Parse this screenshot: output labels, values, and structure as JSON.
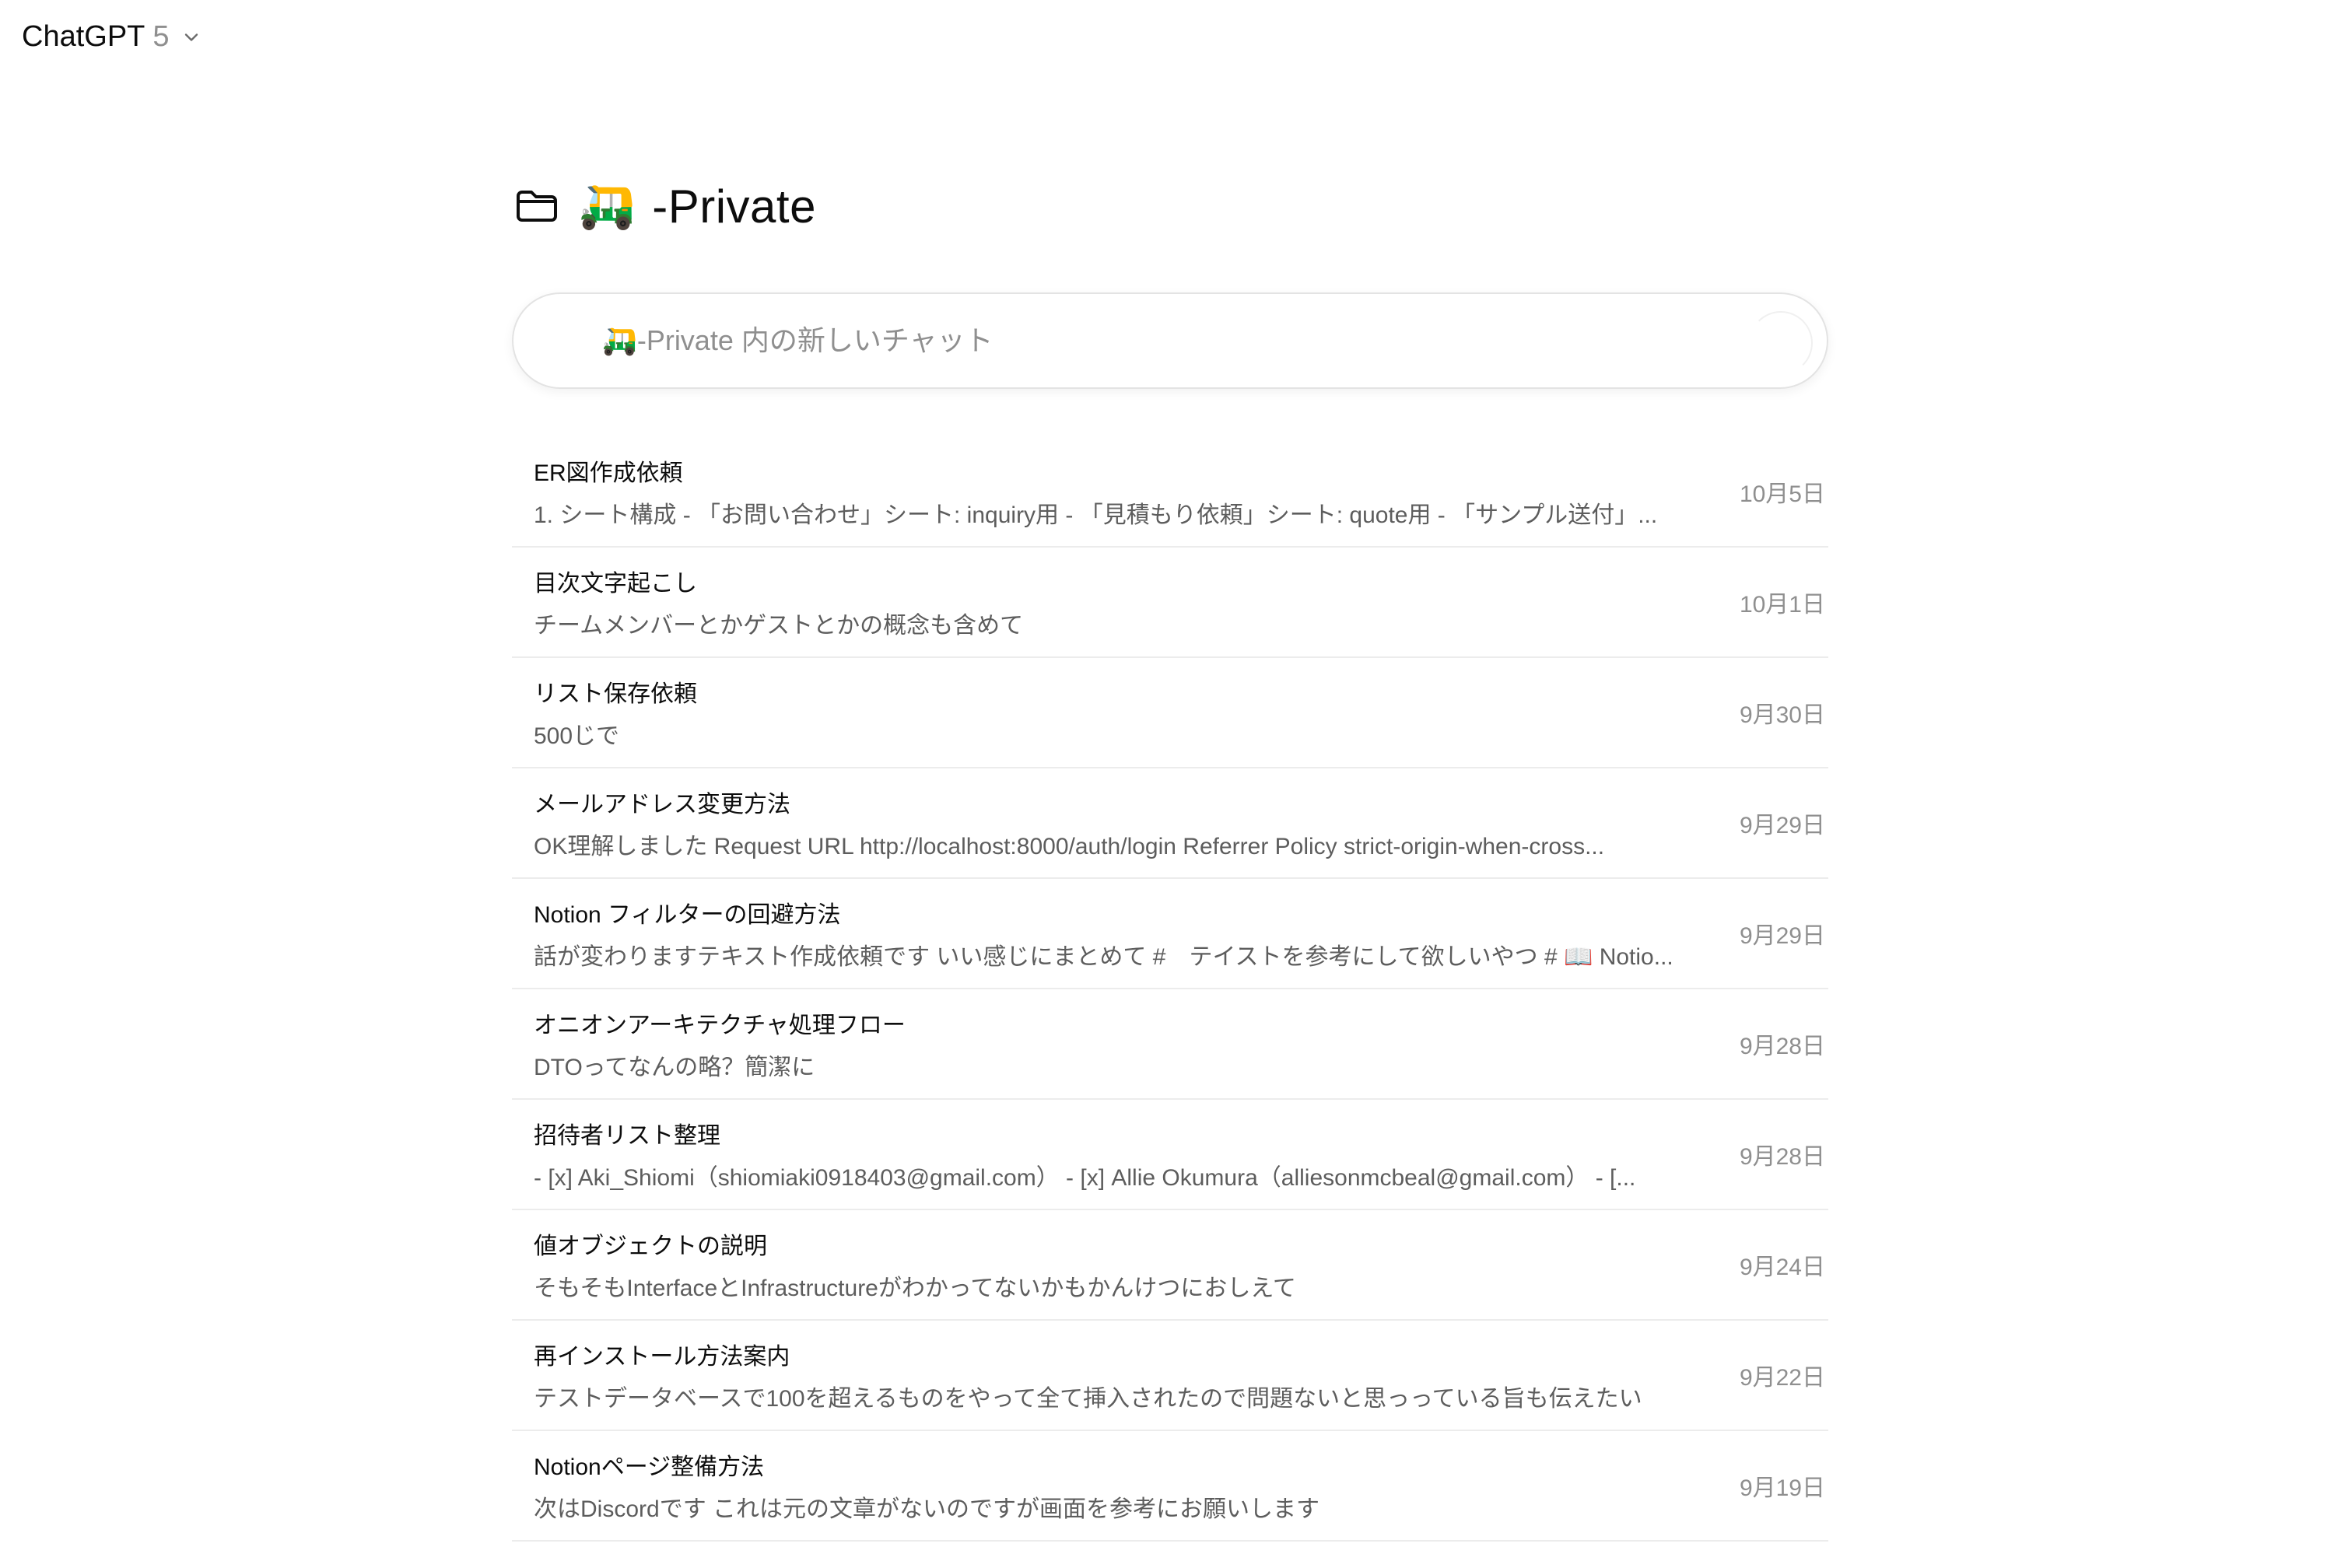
{
  "app": {
    "model_name": "ChatGPT",
    "model_version": "5"
  },
  "project": {
    "emoji": "🛺",
    "title": "-Private"
  },
  "composer": {
    "placeholder": "🛺-Private 内の新しいチャット"
  },
  "chats": [
    {
      "title": "ER図作成依頼",
      "preview": "1. シート構成 - 「お問い合わせ」シート: inquiry用 - 「見積もり依頼」シート: quote用 - 「サンプル送付」...",
      "date": "10月5日"
    },
    {
      "title": "目次文字起こし",
      "preview": "チームメンバーとかゲストとかの概念も含めて",
      "date": "10月1日"
    },
    {
      "title": "リスト保存依頼",
      "preview": "500じで",
      "date": "9月30日"
    },
    {
      "title": "メールアドレス変更方法",
      "preview": "OK理解しました Request URL http://localhost:8000/auth/login Referrer Policy strict-origin-when-cross...",
      "date": "9月29日"
    },
    {
      "title": "Notion フィルターの回避方法",
      "preview": "話が変わりますテキスト作成依頼です いい感じにまとめて #　テイストを参考にして欲しいやつ # 📖 Notio...",
      "date": "9月29日"
    },
    {
      "title": "オニオンアーキテクチャ処理フロー",
      "preview": "DTOってなんの略？簡潔に",
      "date": "9月28日"
    },
    {
      "title": "招待者リスト整理",
      "preview": "- [x] Aki_Shiomi（shiomiaki0918403@gmail.com） - [x] Allie Okumura（alliesonmcbeal@gmail.com） - [...",
      "date": "9月28日"
    },
    {
      "title": "値オブジェクトの説明",
      "preview": "そもそもInterfaceとInfrastructureがわかってないかもかんけつにおしえて",
      "date": "9月24日"
    },
    {
      "title": "再インストール方法案内",
      "preview": "テストデータベースで100を超えるものをやって全て挿入されたので問題ないと思っっている旨も伝えたい",
      "date": "9月22日"
    },
    {
      "title": "Notionページ整備方法",
      "preview": "次はDiscordです これは元の文章がないのですが画面を参考にお願いします",
      "date": "9月19日"
    }
  ]
}
